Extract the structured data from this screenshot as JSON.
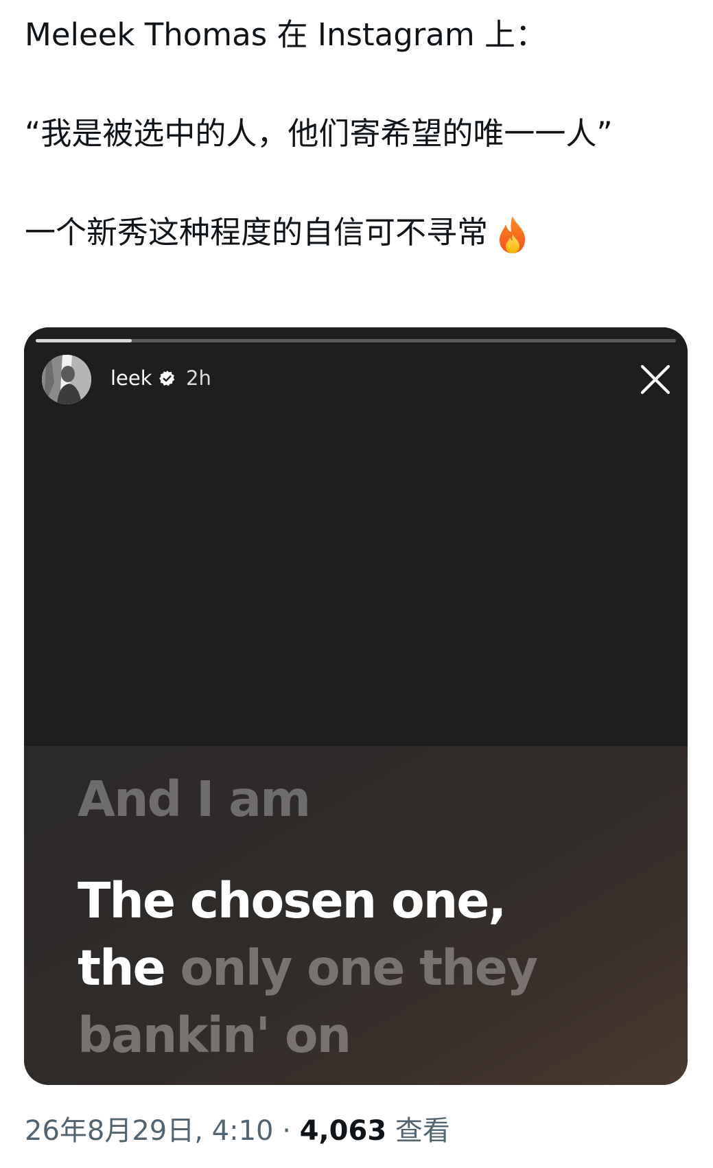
{
  "tweet": {
    "line1": "Meleek Thomas 在 Instagram 上：",
    "line2": "“我是被选中的人，他们寄希望的唯一一人”",
    "line3": "一个新秀这种程度的自信可不寻常",
    "line3_emoji": "fire-icon"
  },
  "story": {
    "username": "leek",
    "verified_icon": "verified-badge-icon",
    "time": "2h",
    "progress": 0.15,
    "lyrics": {
      "line1": "And I am",
      "line2": "The chosen one,",
      "line3_bright": "the",
      "line3_dim": "only one they",
      "line4": "bankin' on"
    }
  },
  "meta": {
    "date": "26年8月29日, 4:10",
    "separator": "·",
    "views_count": "4,063",
    "views_label": "查看"
  }
}
